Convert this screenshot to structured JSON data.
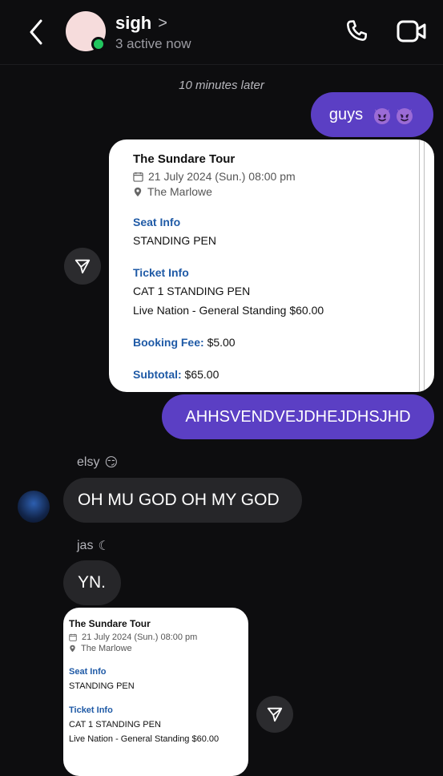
{
  "header": {
    "chat_name": "sigh",
    "chevron": ">",
    "status": "3 active now",
    "icons": [
      "back-arrow-icon",
      "phone-icon",
      "video-icon"
    ],
    "online_color": "#22c55e"
  },
  "thread": {
    "timestamp": "10 minutes later",
    "msg1": {
      "text": "guys",
      "emoji": "😈😈"
    },
    "ticket1": {
      "title": "The Sundare Tour",
      "date": "21 July 2024 (Sun.) 08:00 pm",
      "venue": "The Marlowe",
      "seat_label": "Seat Info",
      "seat_value": "STANDING PEN",
      "ticket_label": "Ticket Info",
      "ticket_line1": "CAT 1 STANDING PEN",
      "ticket_line2": "Live Nation - General Standing $60.00",
      "booking_label": "Booking Fee:",
      "booking_value": "$5.00",
      "subtotal_label": "Subtotal:",
      "subtotal_value": "$65.00"
    },
    "msg2": {
      "text": "AHHSVENDVEJDHEJDHSJHD"
    },
    "sender_elsy": {
      "name": "elsy",
      "emoji": "😏"
    },
    "msg3": {
      "text": "OH MU GOD OH MY GOD"
    },
    "sender_jas": {
      "name": "jas",
      "emoji": "☾"
    },
    "msg4": {
      "text": "YN."
    },
    "ticket2": {
      "title": "The Sundare Tour",
      "date": "21 July 2024 (Sun.) 08:00 pm",
      "venue": "The Marlowe",
      "seat_label": "Seat Info",
      "seat_value": "STANDING PEN",
      "ticket_label": "Ticket Info",
      "ticket_line1": "CAT 1 STANDING PEN",
      "ticket_line2": "Live Nation - General Standing $60.00"
    }
  },
  "colors": {
    "background": "#0d0d0f",
    "outgoing_bubble": "#5b3fc4",
    "incoming_bubble": "#262629",
    "ticket_label_blue": "#1f5aa6"
  }
}
